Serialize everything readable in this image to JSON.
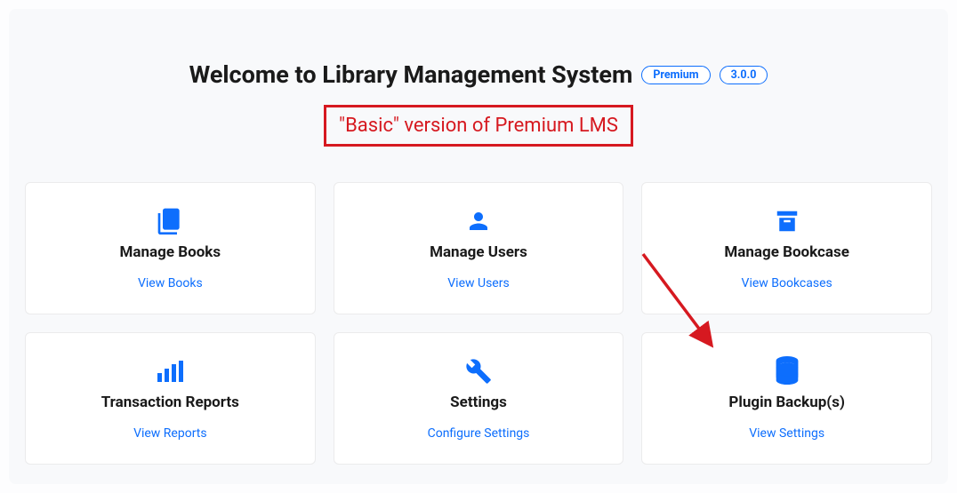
{
  "header": {
    "title": "Welcome to Library Management System",
    "badge_premium": "Premium",
    "badge_version": "3.0.0",
    "subtitle": "\"Basic\" version of Premium LMS"
  },
  "cards": [
    {
      "icon": "book-icon",
      "title": "Manage Books",
      "link_label": "View Books"
    },
    {
      "icon": "user-icon",
      "title": "Manage Users",
      "link_label": "View Users"
    },
    {
      "icon": "archive-icon",
      "title": "Manage Bookcase",
      "link_label": "View Bookcases"
    },
    {
      "icon": "bar-chart-icon",
      "title": "Transaction Reports",
      "link_label": "View Reports"
    },
    {
      "icon": "wrench-icon",
      "title": "Settings",
      "link_label": "Configure Settings"
    },
    {
      "icon": "database-icon",
      "title": "Plugin Backup(s)",
      "link_label": "View Settings"
    }
  ]
}
